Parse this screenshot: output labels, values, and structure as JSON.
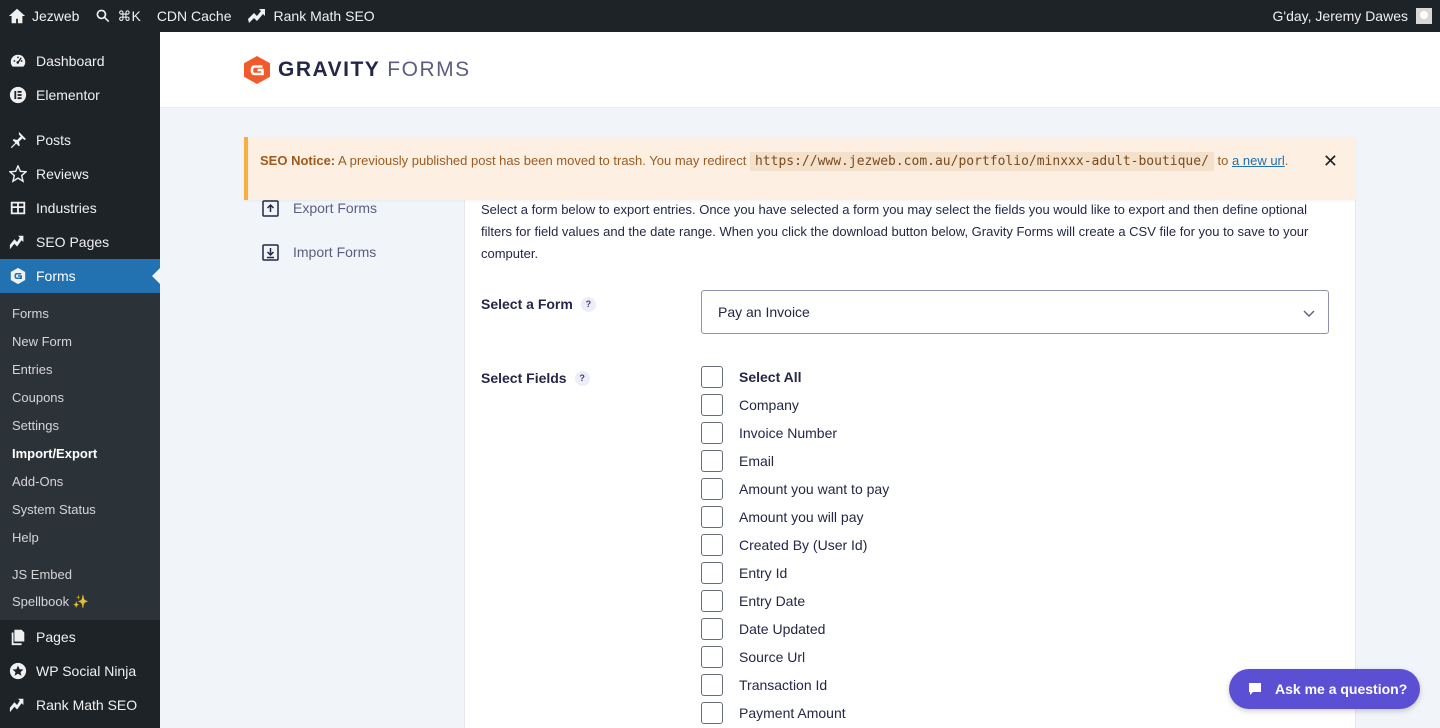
{
  "adminbar": {
    "site": "Jezweb",
    "shortcut": "⌘K",
    "cdn": "CDN Cache",
    "rankmath": "Rank Math SEO",
    "greeting": "G'day, Jeremy Dawes"
  },
  "sidebar": {
    "top": [
      "Dashboard",
      "Elementor"
    ],
    "mid": [
      "Posts",
      "Reviews",
      "Industries",
      "SEO Pages"
    ],
    "active": "Forms",
    "submenu": [
      "Forms",
      "New Form",
      "Entries",
      "Coupons",
      "Settings",
      "Import/Export",
      "Add-Ons",
      "System Status",
      "Help"
    ],
    "submenu_extra": [
      "JS Embed",
      "Spellbook ✨"
    ],
    "bottom": [
      "Pages",
      "WP Social Ninja",
      "Rank Math SEO"
    ]
  },
  "header": {
    "brand_bold": "GRAVITY",
    "brand_light": "FORMS"
  },
  "nav": {
    "export_forms": "Export Forms",
    "import_forms": "Import Forms"
  },
  "notice": {
    "label": "SEO Notice:",
    "text": "A previously published post has been moved to trash. You may redirect",
    "url": "https://www.jezweb.com.au/portfolio/minxxx-adult-boutique/",
    "to": "to",
    "link": "a new url",
    "end": ".",
    "close": "✕"
  },
  "panel": {
    "description": "Select a form below to export entries. Once you have selected a form you may select the fields you would like to export and then define optional filters for field values and the date range. When you click the download button below, Gravity Forms will create a CSV file for you to save to your computer.",
    "select_form_label": "Select a Form",
    "select_fields_label": "Select Fields",
    "help": "?",
    "selected_form": "Pay an Invoice",
    "fields": [
      "Select All",
      "Company",
      "Invoice Number",
      "Email",
      "Amount you want to pay",
      "Amount you will pay",
      "Created By (User Id)",
      "Entry Id",
      "Entry Date",
      "Date Updated",
      "Source Url",
      "Transaction Id",
      "Payment Amount"
    ]
  },
  "chat": {
    "label": "Ask me a question?"
  },
  "colors": {
    "accent": "#2271b1",
    "brand": "#f15a2b",
    "chat": "#5b4fd4",
    "notice_border": "#f6b042"
  }
}
